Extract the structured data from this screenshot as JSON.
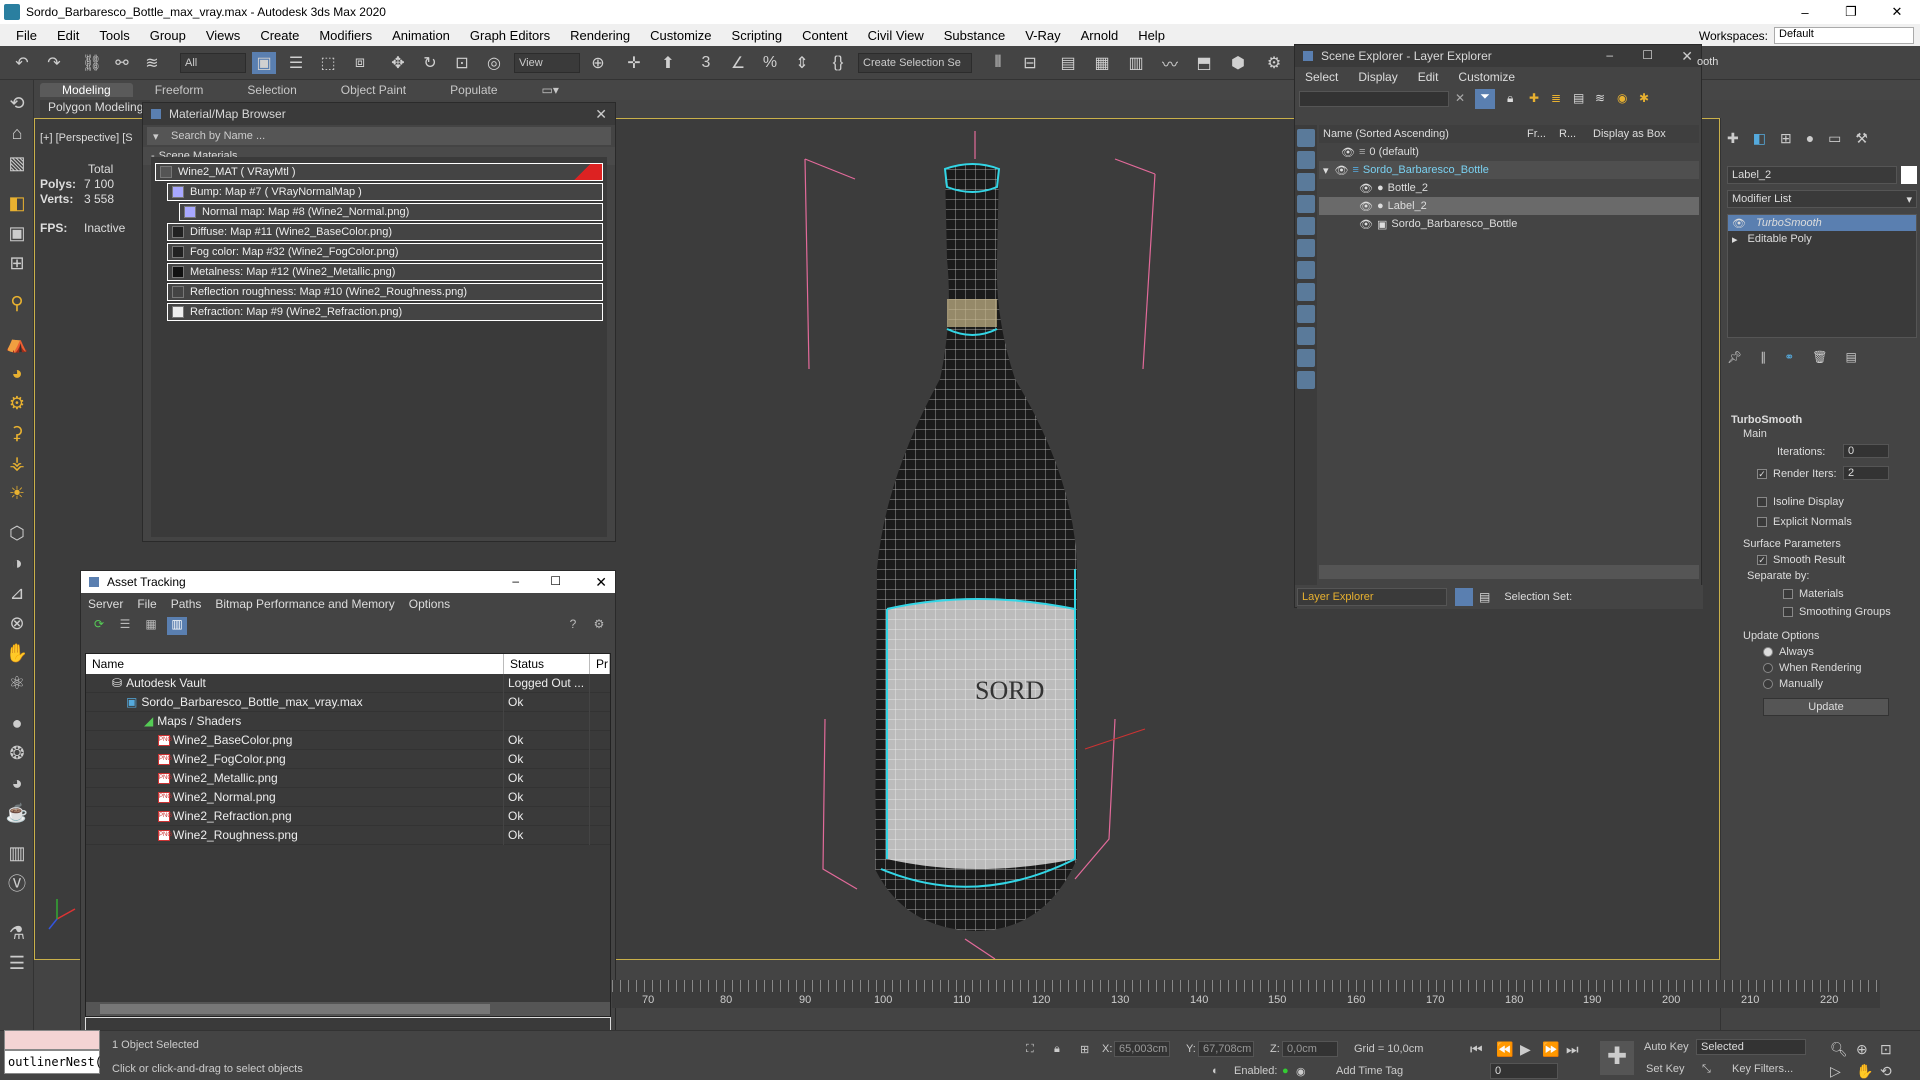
{
  "window": {
    "title": "Sordo_Barbaresco_Bottle_max_vray.max - Autodesk 3ds Max 2020"
  },
  "menu": [
    "File",
    "Edit",
    "Tools",
    "Group",
    "Views",
    "Create",
    "Modifiers",
    "Animation",
    "Graph Editors",
    "Rendering",
    "Customize",
    "Scripting",
    "Content",
    "Civil View",
    "Substance",
    "V-Ray",
    "Arnold",
    "Help"
  ],
  "workspace": {
    "label": "Workspaces:",
    "value": "Default"
  },
  "toolbar": {
    "filter": "All",
    "view": "View",
    "selection_set": "Create Selection Se"
  },
  "ribbon": {
    "tabs": [
      "Modeling",
      "Freeform",
      "Selection",
      "Object Paint",
      "Populate"
    ],
    "sub": "Polygon Modeling"
  },
  "viewport": {
    "label": "[+] [Perspective] [S",
    "stats_total": "Total",
    "polys_label": "Polys:",
    "polys": "7 100",
    "verts_label": "Verts:",
    "verts": "3 558",
    "fps_label": "FPS:",
    "fps": "Inactive"
  },
  "material_browser": {
    "title": "Material/Map Browser",
    "search": "Search by Name ...",
    "section": "Scene Materials",
    "items": [
      "Wine2_MAT  ( VRayMtl )",
      "Bump: Map #7  ( VRayNormalMap )",
      "Normal map: Map #8 (Wine2_Normal.png)",
      "Diffuse: Map #11 (Wine2_BaseColor.png)",
      "Fog color: Map #32 (Wine2_FogColor.png)",
      "Metalness: Map #12 (Wine2_Metallic.png)",
      "Reflection roughness: Map #10 (Wine2_Roughness.png)",
      "Refraction: Map #9 (Wine2_Refraction.png)"
    ]
  },
  "asset_tracking": {
    "title": "Asset Tracking",
    "menu": [
      "Server",
      "File",
      "Paths",
      "Bitmap Performance and Memory",
      "Options"
    ],
    "columns": [
      "Name",
      "Status",
      "Pr"
    ],
    "rows": [
      {
        "name": "Autodesk Vault",
        "status": "Logged Out ..."
      },
      {
        "name": "Sordo_Barbaresco_Bottle_max_vray.max",
        "status": "Ok"
      },
      {
        "name": "Maps / Shaders",
        "status": ""
      },
      {
        "name": "Wine2_BaseColor.png",
        "status": "Ok"
      },
      {
        "name": "Wine2_FogColor.png",
        "status": "Ok"
      },
      {
        "name": "Wine2_Metallic.png",
        "status": "Ok"
      },
      {
        "name": "Wine2_Normal.png",
        "status": "Ok"
      },
      {
        "name": "Wine2_Refraction.png",
        "status": "Ok"
      },
      {
        "name": "Wine2_Roughness.png",
        "status": "Ok"
      }
    ]
  },
  "scene_explorer": {
    "title": "Scene Explorer - Layer Explorer",
    "menu": [
      "Select",
      "Display",
      "Edit",
      "Customize"
    ],
    "columns": [
      "Name (Sorted Ascending)",
      "Fr...",
      "R...",
      "Display as Box"
    ],
    "rows": [
      "0 (default)",
      "Sordo_Barbaresco_Bottle",
      "Bottle_2",
      "Label_2",
      "Sordo_Barbaresco_Bottle"
    ],
    "footer_left": "Layer Explorer",
    "footer_right": "Selection Set:"
  },
  "command_panel": {
    "object_name": "Label_2",
    "modifier_list": "Modifier List",
    "stack": [
      "TurboSmooth",
      "Editable Poly"
    ],
    "rollout": "TurboSmooth",
    "main": "Main",
    "iterations_label": "Iterations:",
    "iterations": "0",
    "render_iters_label": "Render Iters:",
    "render_iters": "2",
    "isoline": "Isoline Display",
    "explicit": "Explicit Normals",
    "surface": "Surface Parameters",
    "smooth": "Smooth Result",
    "separate": "Separate by:",
    "materials": "Materials",
    "smoothing": "Smoothing Groups",
    "update_options": "Update Options",
    "always": "Always",
    "when_rendering": "When Rendering",
    "manually": "Manually",
    "update_btn": "Update",
    "ooth": "ooth"
  },
  "timeline": {
    "ticks": [
      "70",
      "80",
      "90",
      "100",
      "110",
      "120",
      "130",
      "140",
      "150",
      "160",
      "170",
      "180",
      "190",
      "200",
      "210",
      "220"
    ]
  },
  "status": {
    "selected": "1 Object Selected",
    "hint": "Click or click-and-drag to select objects",
    "x_label": "X:",
    "x": "65,003cm",
    "y_label": "Y:",
    "y": "67,708cm",
    "z_label": "Z:",
    "z": "0,0cm",
    "grid": "Grid = 10,0cm",
    "enabled": "Enabled:",
    "add_time_tag": "Add Time Tag",
    "auto_key": "Auto Key",
    "selected_dd": "Selected",
    "set_key": "Set Key",
    "key_filters": "Key Filters...",
    "frame": "0",
    "maxscript": "outlinerNest("
  },
  "colors": {
    "accent": "#33d6e6",
    "viewport_border": "#c9b04a"
  }
}
